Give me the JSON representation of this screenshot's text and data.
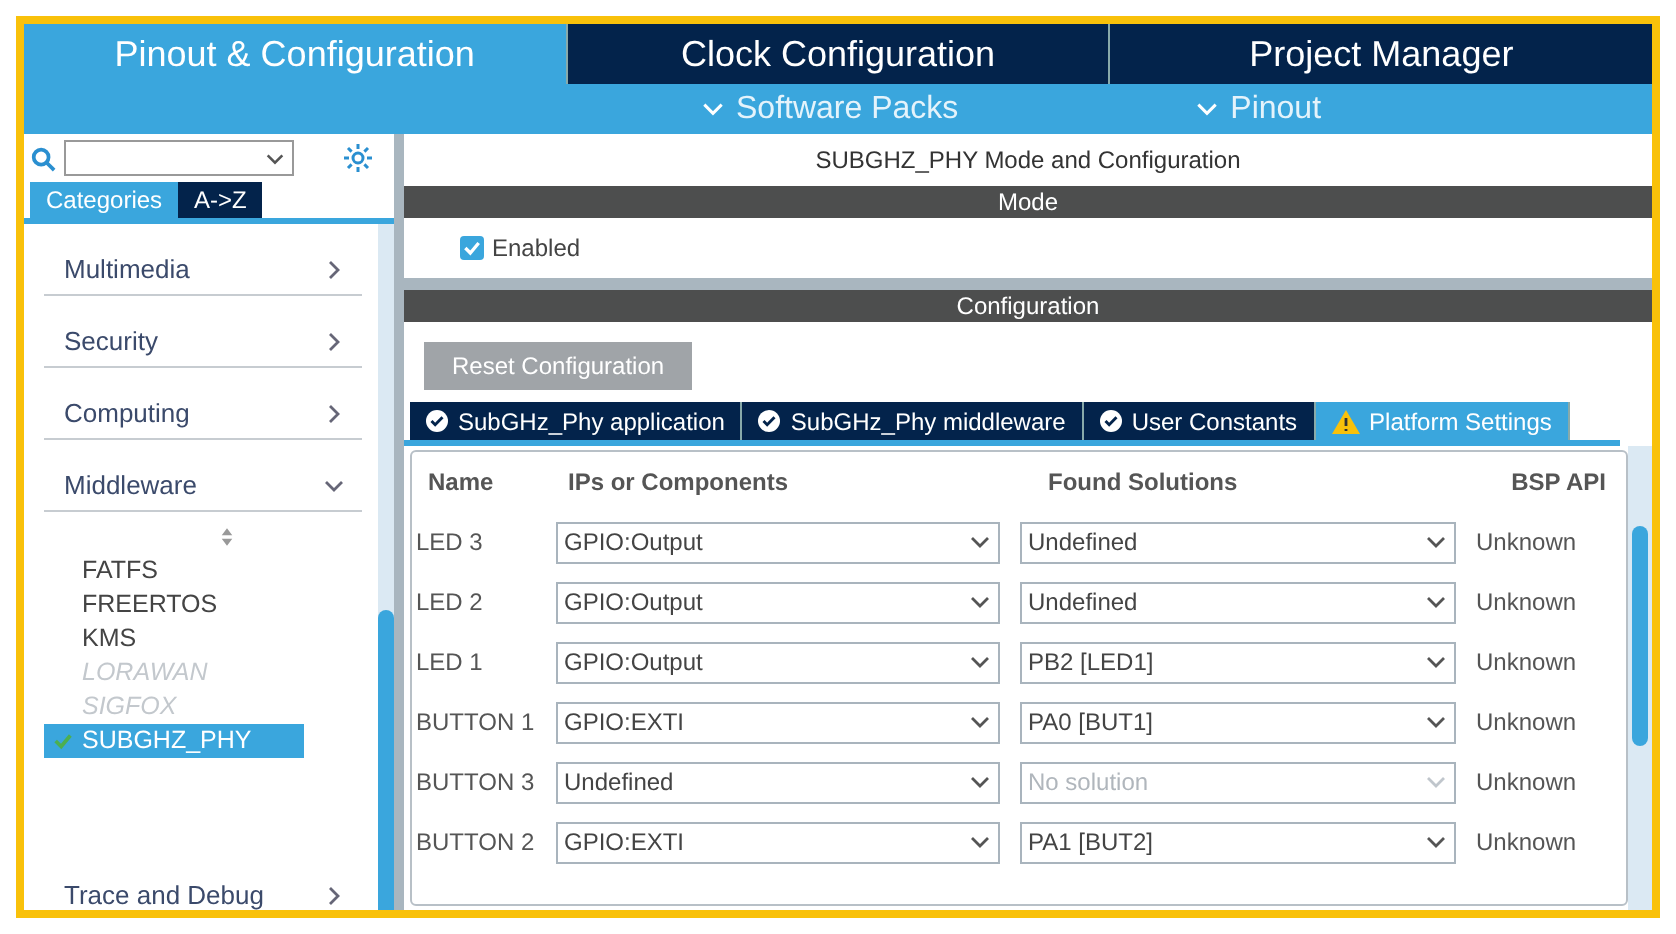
{
  "main_tabs": [
    {
      "label": "Pinout & Configuration",
      "selected": true
    },
    {
      "label": "Clock Configuration",
      "selected": false
    },
    {
      "label": "Project Manager",
      "selected": false
    }
  ],
  "sub_menus": [
    "Software Packs",
    "Pinout"
  ],
  "sidebar": {
    "view_tabs": [
      {
        "label": "Categories",
        "selected": true
      },
      {
        "label": "A->Z",
        "selected": false
      }
    ],
    "categories": [
      {
        "label": "Multimedia",
        "expanded": false
      },
      {
        "label": "Security",
        "expanded": false
      },
      {
        "label": "Computing",
        "expanded": false
      },
      {
        "label": "Middleware",
        "expanded": true,
        "children": [
          {
            "label": "FATFS",
            "disabled": false,
            "selected": false
          },
          {
            "label": "FREERTOS",
            "disabled": false,
            "selected": false
          },
          {
            "label": "KMS",
            "disabled": false,
            "selected": false
          },
          {
            "label": "LORAWAN",
            "disabled": true,
            "selected": false
          },
          {
            "label": "SIGFOX",
            "disabled": true,
            "selected": false
          },
          {
            "label": "SUBGHZ_PHY",
            "disabled": false,
            "selected": true
          }
        ]
      },
      {
        "label": "Trace and Debug",
        "expanded": false
      }
    ]
  },
  "panel": {
    "title": "SUBGHZ_PHY Mode and Configuration",
    "mode_header": "Mode",
    "enabled": {
      "label": "Enabled",
      "checked": true
    },
    "config_header": "Configuration",
    "reset_button": "Reset Configuration",
    "tabs": [
      {
        "label": "SubGHz_Phy application",
        "kind": "ok",
        "selected": false
      },
      {
        "label": "SubGHz_Phy middleware",
        "kind": "ok",
        "selected": false
      },
      {
        "label": "User Constants",
        "kind": "ok",
        "selected": false
      },
      {
        "label": "Platform Settings",
        "kind": "warning",
        "selected": true
      }
    ],
    "table": {
      "columns": [
        "Name",
        "IPs or Components",
        "Found Solutions",
        "BSP API"
      ],
      "rows": [
        {
          "name": "LED 3",
          "ip": "GPIO:Output",
          "solution": "Undefined",
          "solution_disabled": false,
          "bsp": "Unknown"
        },
        {
          "name": "LED 2",
          "ip": "GPIO:Output",
          "solution": "Undefined",
          "solution_disabled": false,
          "bsp": "Unknown"
        },
        {
          "name": "LED 1",
          "ip": "GPIO:Output",
          "solution": "PB2 [LED1]",
          "solution_disabled": false,
          "bsp": "Unknown"
        },
        {
          "name": "BUTTON 1",
          "ip": "GPIO:EXTI",
          "solution": "PA0 [BUT1]",
          "solution_disabled": false,
          "bsp": "Unknown"
        },
        {
          "name": "BUTTON 3",
          "ip": "Undefined",
          "solution": "No solution",
          "solution_disabled": true,
          "bsp": "Unknown"
        },
        {
          "name": "BUTTON 2",
          "ip": "GPIO:EXTI",
          "solution": "PA1 [BUT2]",
          "solution_disabled": false,
          "bsp": "Unknown"
        }
      ]
    }
  }
}
